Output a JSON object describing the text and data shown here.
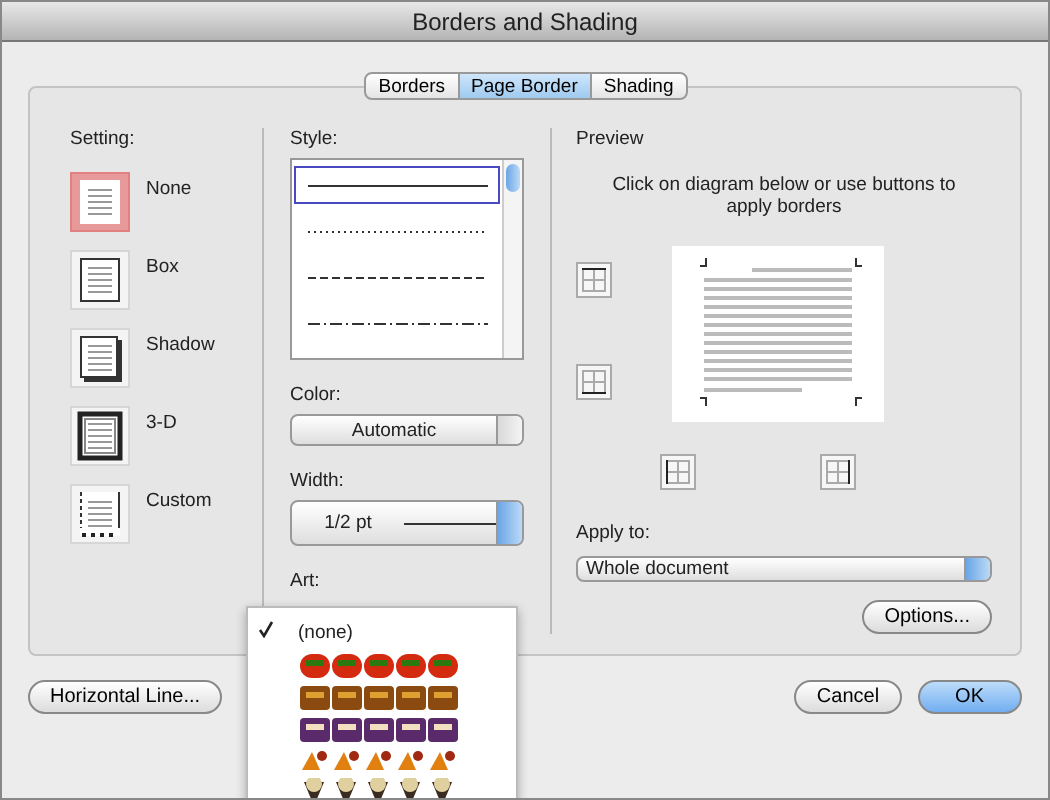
{
  "window": {
    "title": "Borders and Shading"
  },
  "tabs": [
    {
      "label": "Borders",
      "selected": false
    },
    {
      "label": "Page Border",
      "selected": true
    },
    {
      "label": "Shading",
      "selected": false
    }
  ],
  "setting": {
    "label": "Setting:",
    "items": [
      {
        "kind": "none",
        "label": "None",
        "selected": true
      },
      {
        "kind": "box",
        "label": "Box",
        "selected": false
      },
      {
        "kind": "shadow",
        "label": "Shadow",
        "selected": false
      },
      {
        "kind": "threed",
        "label": "3-D",
        "selected": false
      },
      {
        "kind": "custom",
        "label": "Custom",
        "selected": false
      }
    ]
  },
  "style": {
    "label": "Style:",
    "items": [
      {
        "kind": "solid",
        "selected": true
      },
      {
        "kind": "dotted",
        "selected": false
      },
      {
        "kind": "dashed",
        "selected": false
      },
      {
        "kind": "dashdot",
        "selected": false
      }
    ]
  },
  "color": {
    "label": "Color:",
    "value": "Automatic"
  },
  "width": {
    "label": "Width:",
    "value": "1/2 pt"
  },
  "art": {
    "label": "Art:",
    "options": [
      {
        "kind": "text",
        "label": "(none)",
        "selected": true
      },
      {
        "kind": "apples",
        "selected": false
      },
      {
        "kind": "cupcakes",
        "selected": false
      },
      {
        "kind": "cake-slices",
        "selected": false
      },
      {
        "kind": "candy",
        "selected": false
      },
      {
        "kind": "ice-creams",
        "selected": false
      }
    ]
  },
  "preview": {
    "label": "Preview",
    "instruction": "Click on diagram below or use buttons to apply borders"
  },
  "apply_to": {
    "label": "Apply to:",
    "value": "Whole document"
  },
  "buttons": {
    "options": "Options...",
    "horizontal_line": "Horizontal Line...",
    "cancel": "Cancel",
    "ok": "OK"
  }
}
